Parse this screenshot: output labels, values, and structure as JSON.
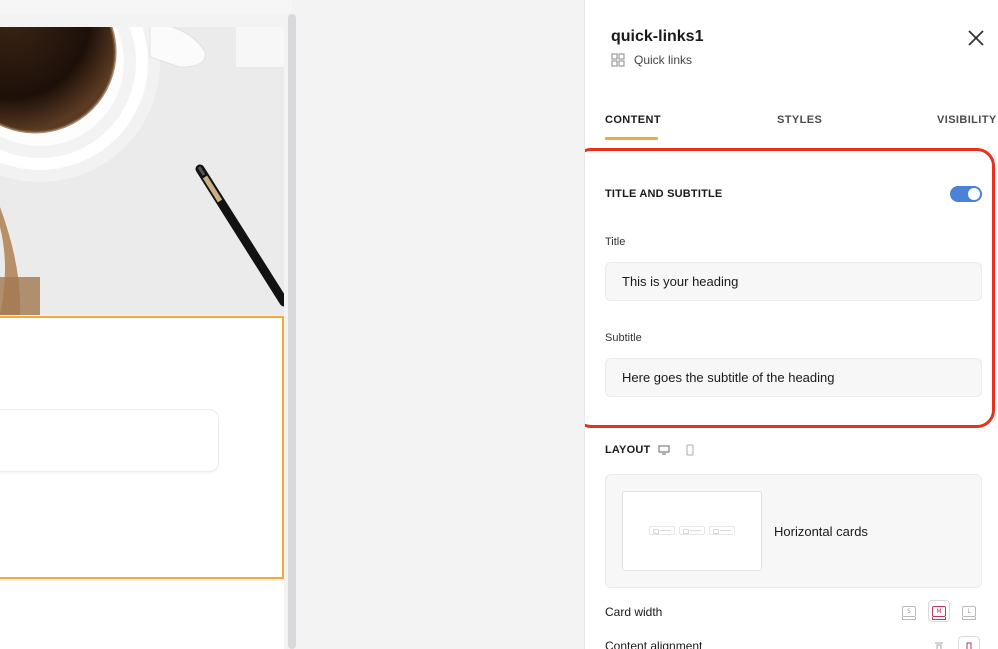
{
  "panel": {
    "title": "quick-links1",
    "component_type": "Quick links",
    "tabs": [
      {
        "label": "CONTENT",
        "active": true
      },
      {
        "label": "STYLES",
        "active": false
      },
      {
        "label": "VISIBILITY",
        "active": false
      }
    ],
    "title_subtitle": {
      "heading": "TITLE AND SUBTITLE",
      "enabled": true,
      "title_label": "Title",
      "title_value": "This is your heading",
      "subtitle_label": "Subtitle",
      "subtitle_value": "Here goes the subtitle of the heading"
    },
    "layout": {
      "heading": "LAYOUT",
      "selected_name": "Horizontal cards"
    },
    "card_width": {
      "label": "Card width",
      "options": [
        "S",
        "M",
        "L"
      ],
      "selected": "M"
    },
    "content_alignment": {
      "label": "Content alignment"
    }
  },
  "colors": {
    "accent": "#f3a93a",
    "toggle_on": "#4b82d8",
    "highlight": "#e8301c",
    "selected_option": "#c0335a"
  }
}
